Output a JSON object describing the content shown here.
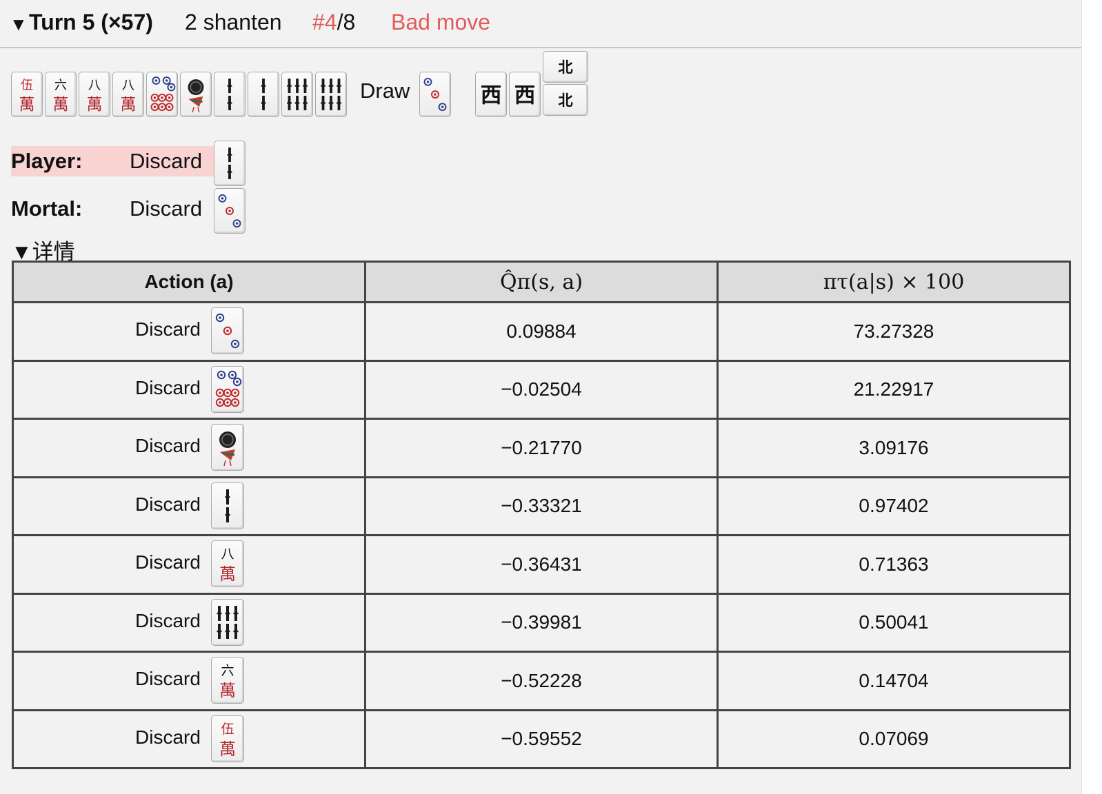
{
  "header": {
    "toggle_icon": "▼",
    "turn": "Turn 5 (×57)",
    "shanten": "2 shanten",
    "rank_highlight": "#4",
    "rank_rest": "/8",
    "verdict": "Bad move",
    "verdict_color": "#e35a5a"
  },
  "hand": {
    "tiles": [
      "5m-red",
      "6m",
      "8m",
      "8m",
      "6p",
      "1s",
      "2s",
      "2s",
      "6s",
      "6s"
    ],
    "draw_label": "Draw",
    "draw_tile": "3p",
    "melds": [
      "west",
      "west",
      "north",
      "north"
    ]
  },
  "player": {
    "label": "Player:",
    "action": "Discard",
    "tile": "2s",
    "highlight_color": "#f9d2d2"
  },
  "mortal": {
    "label": "Mortal:",
    "action": "Discard",
    "tile": "3p"
  },
  "details": {
    "toggle": "▼详情",
    "columns": [
      "Action (a)",
      "Q̂π(s, a)",
      "πτ(a|s) × 100"
    ],
    "rows": [
      {
        "action": "Discard",
        "tile": "3p",
        "q": "0.09884",
        "pi": "73.27328"
      },
      {
        "action": "Discard",
        "tile": "6p",
        "q": "−0.02504",
        "pi": "21.22917"
      },
      {
        "action": "Discard",
        "tile": "1s",
        "q": "−0.21770",
        "pi": "3.09176"
      },
      {
        "action": "Discard",
        "tile": "2s",
        "q": "−0.33321",
        "pi": "0.97402"
      },
      {
        "action": "Discard",
        "tile": "8m",
        "q": "−0.36431",
        "pi": "0.71363"
      },
      {
        "action": "Discard",
        "tile": "6s",
        "q": "−0.39981",
        "pi": "0.50041"
      },
      {
        "action": "Discard",
        "tile": "6m",
        "q": "−0.52228",
        "pi": "0.14704"
      },
      {
        "action": "Discard",
        "tile": "5m-red",
        "q": "−0.59552",
        "pi": "0.07069"
      }
    ]
  }
}
